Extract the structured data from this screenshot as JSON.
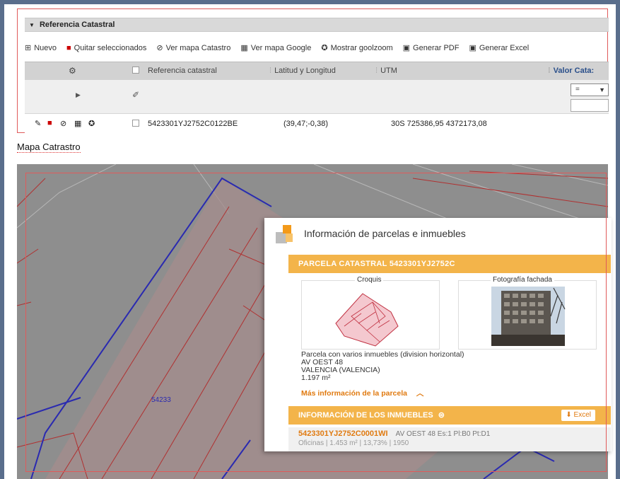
{
  "panel": {
    "title": "Referencia Catastral",
    "toolbar": [
      {
        "label": "Nuevo",
        "icon": "add-icon"
      },
      {
        "label": "Quitar seleccionados",
        "icon": "trash-icon"
      },
      {
        "label": "Ver mapa Catastro",
        "icon": "catastro-icon"
      },
      {
        "label": "Ver mapa Google",
        "icon": "map-icon"
      },
      {
        "label": "Mostrar goolzoom",
        "icon": "goolzoom-icon"
      },
      {
        "label": "Generar PDF",
        "icon": "pdf-icon"
      },
      {
        "label": "Generar Excel",
        "icon": "excel-icon"
      }
    ],
    "columns": [
      "Referencia catastral",
      "Latitud y Longitud",
      "UTM",
      "Valor Cata:"
    ],
    "filter": {
      "operator": "="
    },
    "row": {
      "referencia": "5423301YJ2752C0122BE",
      "latlon": "(39,47;-0,38)",
      "utm": "30S 725386,95 4372173,08"
    }
  },
  "map_section": {
    "title": "Mapa Catrastro",
    "parcel_label": "54233",
    "popup": {
      "title": "Información de parcelas e inmuebles",
      "parcela_header": "PARCELA CATASTRAL 5423301YJ2752C",
      "croquis_label": "Croquis",
      "foto_label": "Fotografía fachada",
      "desc_lines": [
        "Parcela con varios inmuebles (division horizontal)",
        "AV OEST 48",
        "VALENCIA (VALENCIA)",
        "1.197 m²"
      ],
      "more_info": "Más información de la parcela",
      "inmuebles_header": "INFORMACIÓN DE LOS INMUEBLES",
      "excel_label": "Excel",
      "inmueble": {
        "ref": "5423301YJ2752C0001WI",
        "address": "AV OEST 48 Es:1 Pl:B0 Pt:D1",
        "meta": "Oficinas | 1.453 m² | 13,73% | 1950"
      }
    }
  },
  "colors": {
    "accent_orange": "#f3b44a",
    "link_orange": "#e07a10",
    "highlight_red": "#e05a5a"
  }
}
